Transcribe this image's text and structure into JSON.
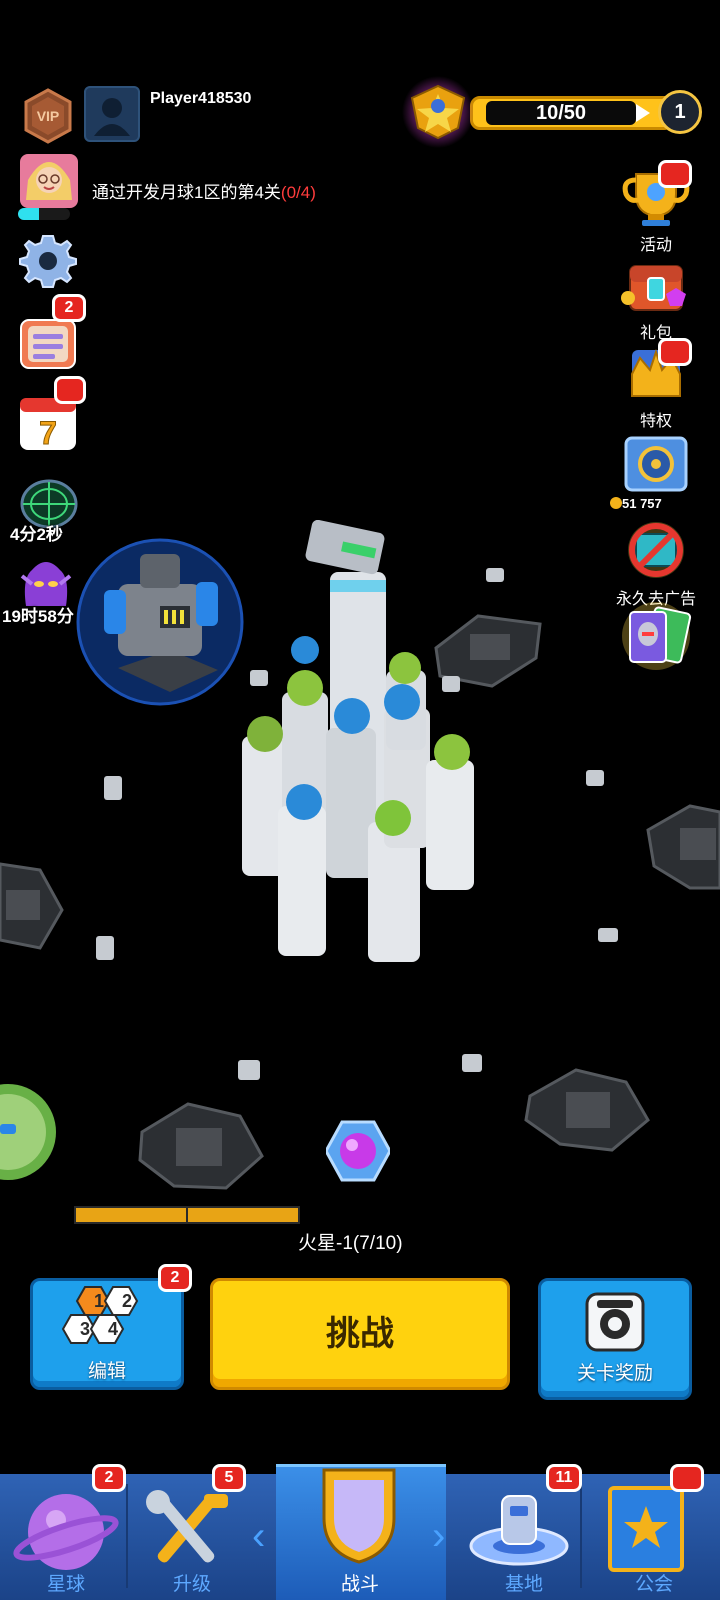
{
  "header": {
    "vip_label": "VIP",
    "player_name": "Player418530",
    "xp": "10/50",
    "level": "1"
  },
  "quest": {
    "text": "通过开发月球1区的第4关",
    "progress": "(0/4)"
  },
  "left_column": {
    "notes_badge": "2",
    "calendar_day": "7",
    "radar_timer": "4分2秒",
    "alien_timer": "19时58分"
  },
  "right_column": {
    "activity_label": "活动",
    "gift_label": "礼包",
    "privilege_label": "特权",
    "coins": "51 757",
    "noads_label": "永久去广告"
  },
  "stage": {
    "label": "火星-1(7/10)",
    "progress_fraction": 0.7
  },
  "actions": {
    "edit_label": "编辑",
    "edit_badge": "2",
    "edit_numbers": [
      "1",
      "2",
      "3",
      "4"
    ],
    "challenge_label": "挑战",
    "reward_label": "关卡奖励"
  },
  "nav": {
    "items": [
      {
        "label": "星球",
        "badge": "2"
      },
      {
        "label": "升级",
        "badge": "5"
      },
      {
        "label": "战斗",
        "badge": ""
      },
      {
        "label": "基地",
        "badge": "11"
      },
      {
        "label": "公会",
        "badge": ""
      }
    ],
    "active": "战斗"
  },
  "colors": {
    "accent_yellow": "#ffd20e",
    "accent_blue": "#1ea0ec",
    "badge_red": "#e52620",
    "progress_text_red": "#ff3c3c"
  }
}
